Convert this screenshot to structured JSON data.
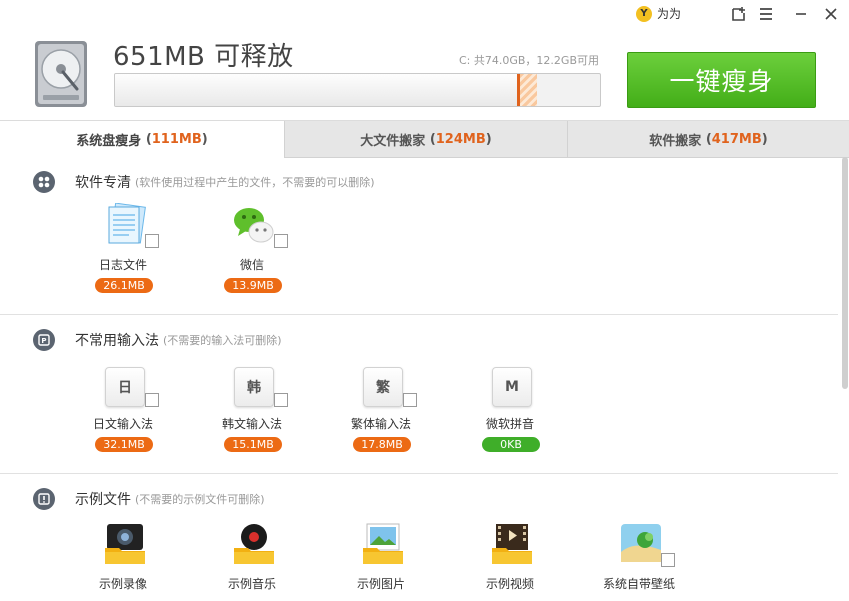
{
  "titlebar": {
    "user_name": "为为",
    "avatar_letter": "Y"
  },
  "header": {
    "headline": "651MB 可释放",
    "disk_info": "C: 共74.0GB，12.2GB可用",
    "used_fraction": 0.835,
    "free_fraction": 0.035,
    "slim_button": "一键瘦身"
  },
  "tabs": [
    {
      "label": "系统盘瘦身",
      "size": "111MB",
      "active": true
    },
    {
      "label": "大文件搬家",
      "size": "124MB",
      "active": false
    },
    {
      "label": "软件搬家",
      "size": "417MB",
      "active": false
    }
  ],
  "sections": {
    "software": {
      "title": "软件专清",
      "desc": "(软件使用过程中产生的文件，不需要的可以删除)",
      "items": [
        {
          "name": "日志文件",
          "size": "26.1MB",
          "icon": "log-file-icon"
        },
        {
          "name": "微信",
          "size": "13.9MB",
          "icon": "wechat-icon"
        }
      ]
    },
    "ime": {
      "title": "不常用输入法",
      "desc": "(不需要的输入法可删除)",
      "items": [
        {
          "name": "日文输入法",
          "size": "32.1MB",
          "glyph": "日"
        },
        {
          "name": "韩文输入法",
          "size": "15.1MB",
          "glyph": "韩"
        },
        {
          "name": "繁体输入法",
          "size": "17.8MB",
          "glyph": "繁"
        },
        {
          "name": "微软拼音",
          "size": "0KB",
          "glyph": "M"
        }
      ]
    },
    "samples": {
      "title": "示例文件",
      "desc": "(不需要的示例文件可删除)",
      "items": [
        {
          "name": "示例录像",
          "icon": "sample-video-record-icon"
        },
        {
          "name": "示例音乐",
          "icon": "sample-music-icon"
        },
        {
          "name": "示例图片",
          "icon": "sample-pictures-icon"
        },
        {
          "name": "示例视频",
          "icon": "sample-videos-icon"
        },
        {
          "name": "系统自带壁纸",
          "icon": "wallpaper-icon"
        }
      ]
    }
  },
  "colors": {
    "accent_orange": "#ec6a14",
    "accent_green": "#43ae18",
    "size_text": "#e0631d"
  }
}
